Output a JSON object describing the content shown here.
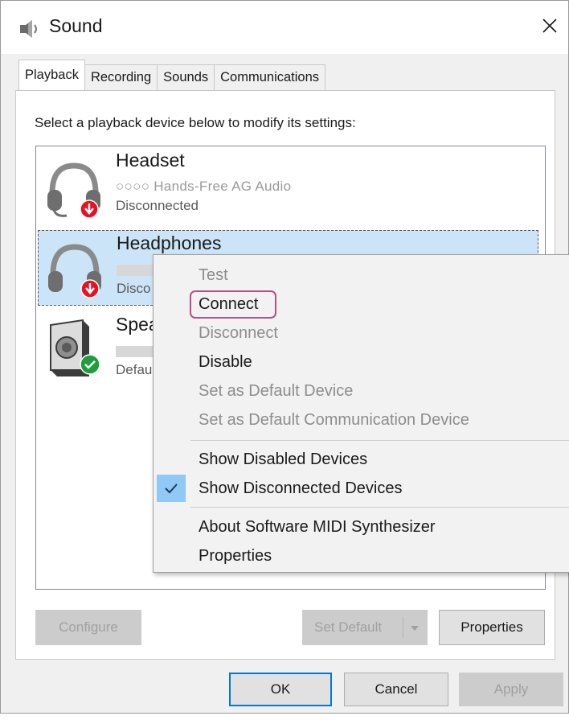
{
  "window": {
    "title": "Sound",
    "close_glyph": "✕"
  },
  "tabs": [
    "Playback",
    "Recording",
    "Sounds",
    "Communications"
  ],
  "instruction": "Select a playback device below to modify its settings:",
  "devices": [
    {
      "name": "Headset",
      "subtitle": "○○○○ Hands-Free AG Audio",
      "status": "Disconnected",
      "icon": "headset-icon",
      "badge": "down-arrow-badge-icon"
    },
    {
      "name": "Headphones",
      "status": "Disco",
      "icon": "headphones-icon",
      "badge": "down-arrow-badge-icon"
    },
    {
      "name": "Spea",
      "status": "Defau",
      "icon": "speaker-icon",
      "badge": "check-badge-icon"
    }
  ],
  "context_menu": {
    "items": [
      {
        "label": "Test",
        "enabled": false
      },
      {
        "label": "Connect",
        "enabled": true
      },
      {
        "label": "Disconnect",
        "enabled": false
      },
      {
        "label": "Disable",
        "enabled": true
      },
      {
        "label": "Set as Default Device",
        "enabled": false
      },
      {
        "label": "Set as Default Communication Device",
        "enabled": false
      },
      {
        "label": "Show Disabled Devices",
        "enabled": true
      },
      {
        "label": "Show Disconnected Devices",
        "enabled": true,
        "checked": true
      },
      {
        "label": "About Software MIDI Synthesizer",
        "enabled": true
      },
      {
        "label": "Properties",
        "enabled": true
      }
    ],
    "highlight_color": "#b74f8b",
    "check_glyph": "✓"
  },
  "buttons": {
    "configure": "Configure",
    "set_default": "Set Default",
    "properties": "Properties",
    "ok": "OK",
    "cancel": "Cancel",
    "apply": "Apply"
  },
  "colors": {
    "selection": "#cce4f7",
    "accent": "#0078d7",
    "check_bg": "#90c8f6",
    "badge_red": "#e81123",
    "badge_green": "#1e9e3e"
  }
}
